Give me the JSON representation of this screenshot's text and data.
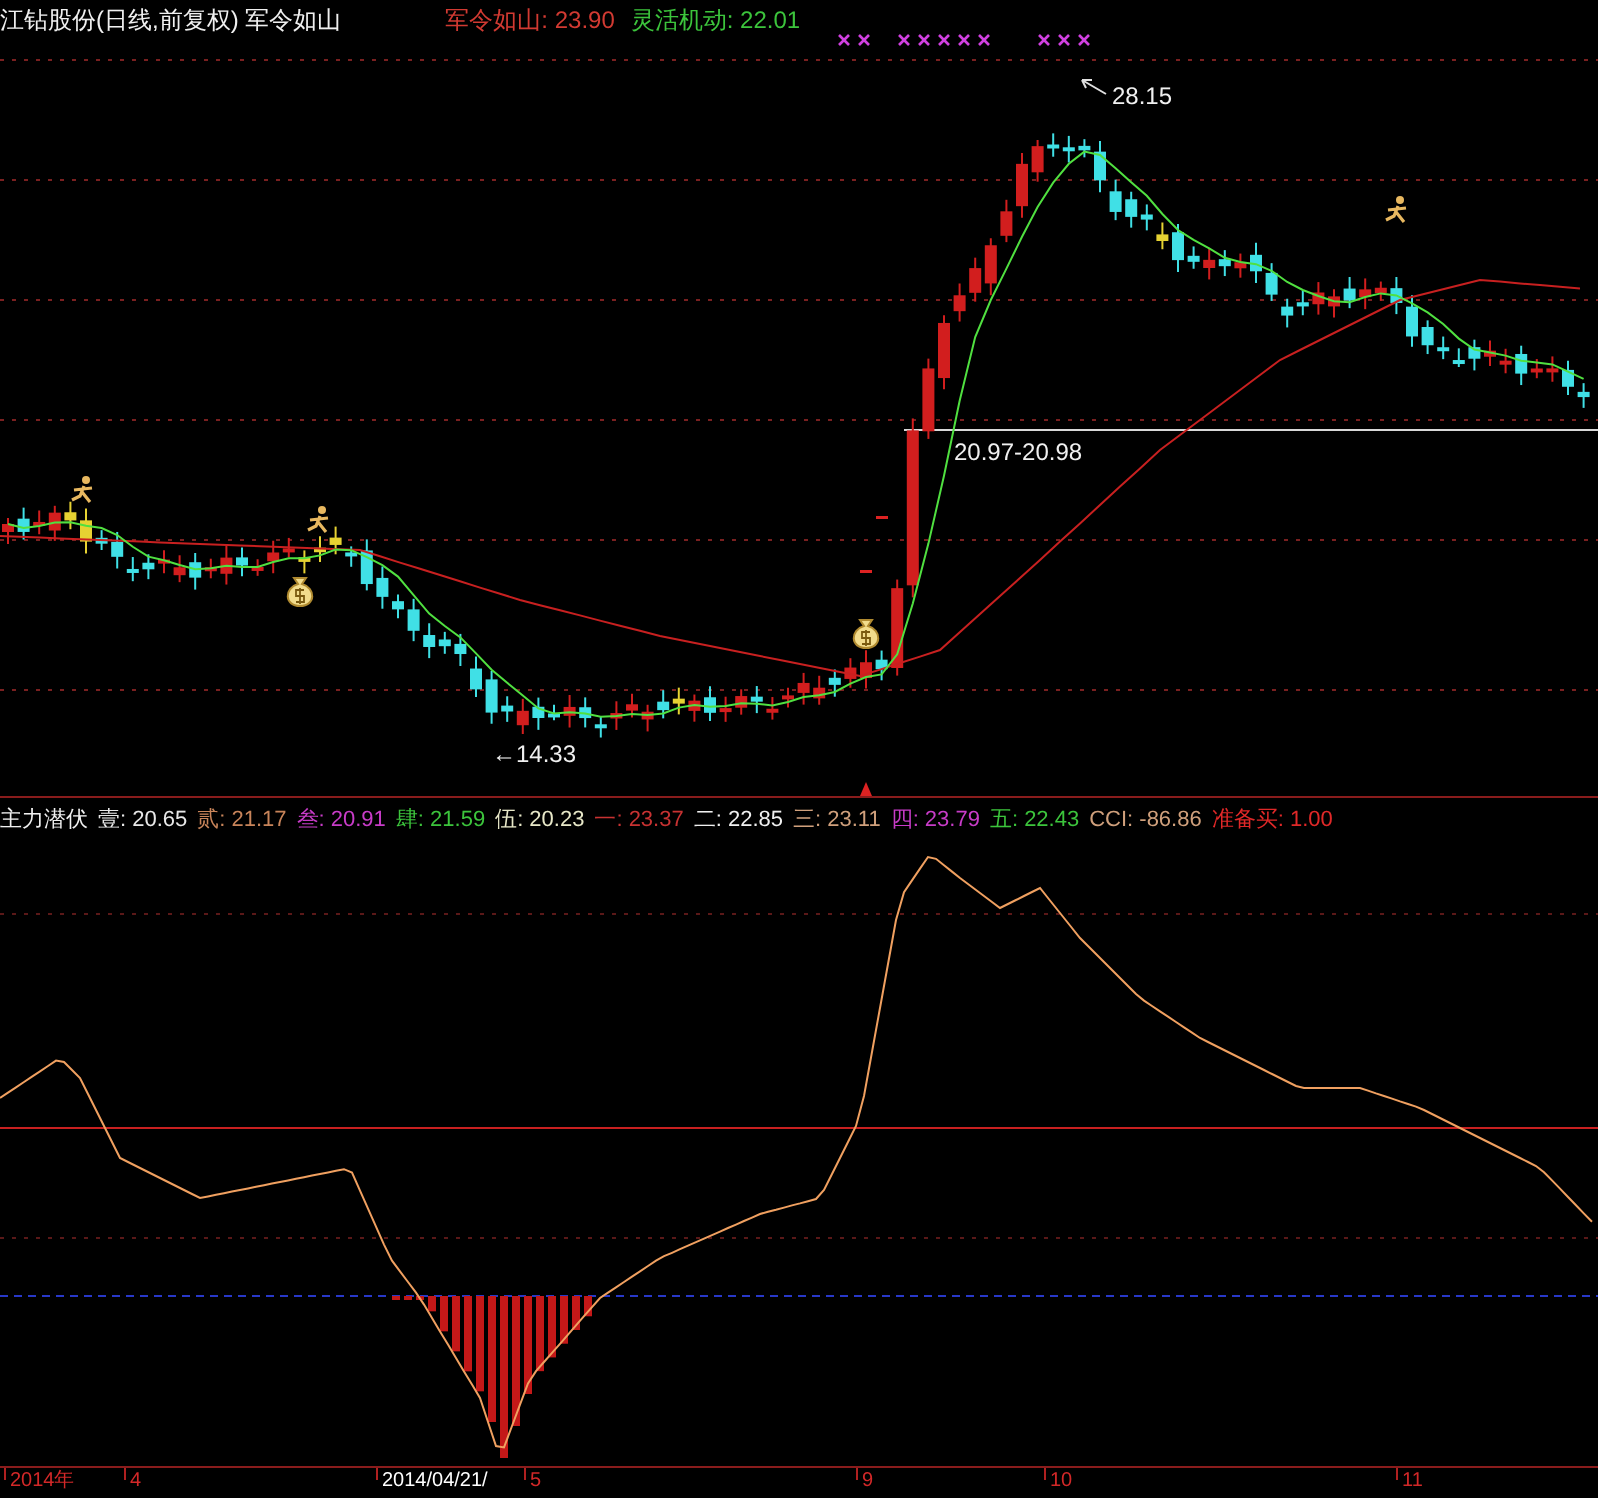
{
  "main_panel": {
    "title": "江钻股份(日线,前复权) 军令如山",
    "indicators": [
      {
        "label": "军令如山: 23.90",
        "color": "#d23a32"
      },
      {
        "label": "灵活机动: 22.01",
        "color": "#3cc43c"
      }
    ],
    "annotations": [
      {
        "text": "28.15"
      },
      {
        "text": "20.97-20.98"
      },
      {
        "text": "←14.33"
      }
    ]
  },
  "sub_panel": {
    "title": "主力潜伏",
    "values": [
      {
        "label": "壹: 20.65",
        "color": "#e8e8e8"
      },
      {
        "label": "贰: 21.17",
        "color": "#c8845a"
      },
      {
        "label": "叁: 20.91",
        "color": "#c83cc8"
      },
      {
        "label": "肆: 21.59",
        "color": "#3cc43c"
      },
      {
        "label": "伍: 20.23",
        "color": "#e8e8c8"
      },
      {
        "label": "一: 23.37",
        "color": "#c83232"
      },
      {
        "label": "二: 22.85",
        "color": "#f0f0f0"
      },
      {
        "label": "三: 23.11",
        "color": "#d0a07c"
      },
      {
        "label": "四: 23.79",
        "color": "#c83cc8"
      },
      {
        "label": "五: 22.43",
        "color": "#3cc43c"
      },
      {
        "label": "CCI: -86.86",
        "color": "#d0a07c"
      },
      {
        "label": "准备买: 1.00",
        "color": "#e02828"
      }
    ]
  },
  "time_axis": {
    "labels": [
      {
        "text": "2014年",
        "selected": false
      },
      {
        "text": "4",
        "selected": false
      },
      {
        "text": "2014/04/21/",
        "selected": true
      },
      {
        "text": "5",
        "selected": false
      },
      {
        "text": "9",
        "selected": false
      },
      {
        "text": "10",
        "selected": false
      },
      {
        "text": "11",
        "selected": false
      }
    ]
  }
}
